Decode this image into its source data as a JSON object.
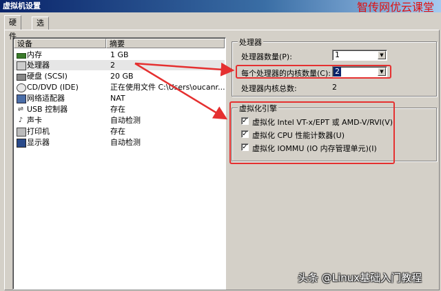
{
  "window": {
    "title": "虚拟机设置"
  },
  "watermark_top": "智传网优云课堂",
  "watermark_bottom": "头条 @Linux基础入门教程",
  "tabs": [
    {
      "label": "硬件",
      "active": true
    },
    {
      "label": "选项",
      "active": false
    }
  ],
  "device_list": {
    "columns": [
      "设备",
      "摘要"
    ],
    "rows": [
      {
        "icon": "memory-icon",
        "name": "内存",
        "summary": "1 GB",
        "selected": false
      },
      {
        "icon": "processor-icon",
        "name": "处理器",
        "summary": "2",
        "selected": true
      },
      {
        "icon": "hard-disk-icon",
        "name": "硬盘 (SCSI)",
        "summary": "20 GB",
        "selected": false
      },
      {
        "icon": "cd-dvd-icon",
        "name": "CD/DVD (IDE)",
        "summary": "正在使用文件 C:\\Users\\oucanr...",
        "selected": false
      },
      {
        "icon": "network-adapter-icon",
        "name": "网络适配器",
        "summary": "NAT",
        "selected": false
      },
      {
        "icon": "usb-icon",
        "name": "USB 控制器",
        "summary": "存在",
        "selected": false
      },
      {
        "icon": "sound-icon",
        "name": "声卡",
        "summary": "自动检测",
        "selected": false
      },
      {
        "icon": "printer-icon",
        "name": "打印机",
        "summary": "存在",
        "selected": false
      },
      {
        "icon": "display-icon",
        "name": "显示器",
        "summary": "自动检测",
        "selected": false
      }
    ]
  },
  "processor": {
    "group_title": "处理器",
    "count_label": "处理器数量(P):",
    "count_value": "1",
    "cores_label": "每个处理器的内核数量(C):",
    "cores_value": "2",
    "total_label": "处理器内核总数:",
    "total_value": "2"
  },
  "virtualization": {
    "group_title": "虚拟化引擎",
    "options": [
      {
        "label": "虚拟化 Intel VT-x/EPT 或 AMD-V/RVI(V)",
        "checked": true
      },
      {
        "label": "虚拟化 CPU 性能计数器(U)",
        "checked": true
      },
      {
        "label": "虚拟化 IOMMU (IO 内存管理单元)(I)",
        "checked": true
      }
    ]
  },
  "colors": {
    "annotation": "#e53030",
    "title_bar": "#0a246a",
    "selection": "#0a246a"
  }
}
